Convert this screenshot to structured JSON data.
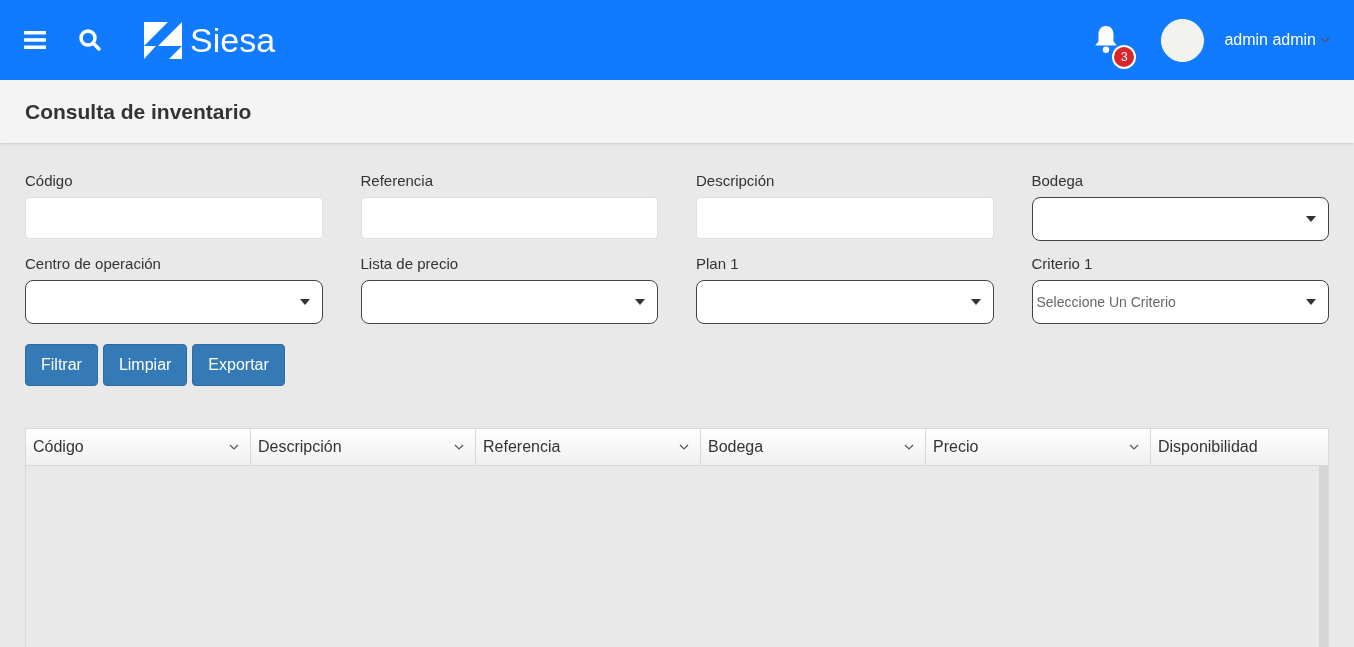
{
  "header": {
    "logo_text": "Siesa",
    "notifications": "3",
    "user": "admin admin"
  },
  "page_title": "Consulta de inventario",
  "filters": [
    {
      "label": "Código",
      "kind": "text"
    },
    {
      "label": "Referencia",
      "kind": "text"
    },
    {
      "label": "Descripción",
      "kind": "text"
    },
    {
      "label": "Bodega",
      "kind": "select"
    },
    {
      "label": "Centro de operación",
      "kind": "select"
    },
    {
      "label": "Lista de precio",
      "kind": "select"
    },
    {
      "label": "Plan 1",
      "kind": "select"
    },
    {
      "label": "Criterio 1",
      "kind": "select",
      "placeholder": "Seleccione Un Criterio"
    }
  ],
  "buttons": [
    "Filtrar",
    "Limpiar",
    "Exportar"
  ],
  "table": {
    "columns": [
      {
        "label": "Código",
        "menu": true
      },
      {
        "label": "Descripción",
        "menu": true
      },
      {
        "label": "Referencia",
        "menu": true
      },
      {
        "label": "Bodega",
        "menu": true
      },
      {
        "label": "Precio",
        "menu": true
      },
      {
        "label": "Disponibilidad",
        "menu": false
      }
    ]
  }
}
